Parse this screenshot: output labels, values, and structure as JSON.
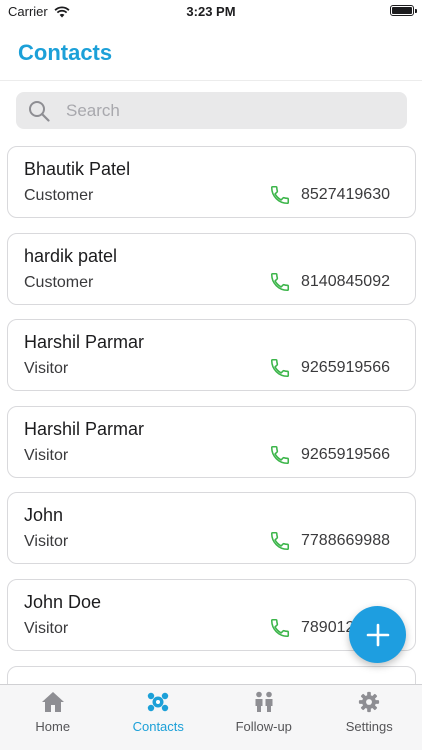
{
  "status_bar": {
    "carrier": "Carrier",
    "time": "3:23 PM"
  },
  "header": {
    "title": "Contacts",
    "accent_color": "#1ca0d8"
  },
  "search": {
    "placeholder": "Search"
  },
  "contacts": [
    {
      "name": "Bhautik Patel",
      "type": "Customer",
      "phone": "8527419630"
    },
    {
      "name": "hardik patel",
      "type": "Customer",
      "phone": "8140845092"
    },
    {
      "name": "Harshil Parmar",
      "type": "Visitor",
      "phone": "9265919566"
    },
    {
      "name": "Harshil Parmar",
      "type": "Visitor",
      "phone": "9265919566"
    },
    {
      "name": "John",
      "type": "Visitor",
      "phone": "7788669988"
    },
    {
      "name": "John Doe",
      "type": "Visitor",
      "phone": "7890123456"
    }
  ],
  "fab": {
    "icon": "plus-icon",
    "color": "#1e9ee0"
  },
  "tabs": [
    {
      "label": "Home",
      "icon": "home-icon",
      "active": false
    },
    {
      "label": "Contacts",
      "icon": "contacts-icon",
      "active": true
    },
    {
      "label": "Follow-up",
      "icon": "follow-up-icon",
      "active": false
    },
    {
      "label": "Settings",
      "icon": "gear-icon",
      "active": false
    }
  ],
  "colors": {
    "phone_icon": "#3cb54a",
    "active_tab": "#1ca0d8",
    "inactive_tab": "#8e8e93"
  }
}
